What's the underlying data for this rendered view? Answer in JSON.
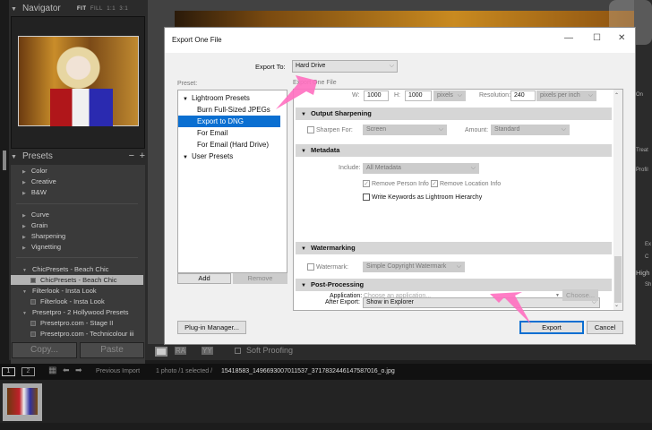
{
  "navigator": {
    "title": "Navigator",
    "options": [
      "FIT",
      "FILL",
      "1:1",
      "3:1"
    ]
  },
  "presets": {
    "title": "Presets",
    "minus": "−",
    "plus": "+",
    "items": [
      {
        "label": "Color",
        "type": "folder"
      },
      {
        "label": "Creative",
        "type": "folder"
      },
      {
        "label": "B&W",
        "type": "folder"
      },
      {
        "label": "Curve",
        "type": "folder"
      },
      {
        "label": "Grain",
        "type": "folder"
      },
      {
        "label": "Sharpening",
        "type": "folder"
      },
      {
        "label": "Vignetting",
        "type": "folder"
      },
      {
        "label": "ChicPresets - Beach Chic",
        "type": "open"
      },
      {
        "label": "ChicPresets - Beach Chic",
        "type": "preset",
        "selected": true
      },
      {
        "label": "Filterlook - Insta Look",
        "type": "open"
      },
      {
        "label": "Filterlook - Insta Look",
        "type": "preset"
      },
      {
        "label": "Presetpro - 2 Hollywood Presets",
        "type": "open"
      },
      {
        "label": "Presetpro.com - Stage II",
        "type": "preset"
      },
      {
        "label": "Presetpro.com - Technicolour iii",
        "type": "preset"
      }
    ]
  },
  "left_buttons": {
    "copy": "Copy...",
    "paste": "Paste"
  },
  "toolbar": {
    "soft_proofing": "Soft Proofing",
    "ra": "RA",
    "yy": "YY"
  },
  "right_panel": {
    "labels": [
      "On",
      "Treat",
      "Profil",
      "Ex",
      "C",
      "High",
      "Sh"
    ]
  },
  "status": {
    "pages": [
      "1",
      "2"
    ],
    "source": "Previous Import",
    "count": "1 photo /1 selected /",
    "filename": "15418583_1496693007011537_3717832446147587016_o.jpg"
  },
  "dialog": {
    "title": "Export One File",
    "export_to_label": "Export To:",
    "export_to_value": "Hard Drive",
    "preset_label": "Preset:",
    "panel_label": "Export One File",
    "preset_tree": [
      {
        "label": "Lightroom Presets",
        "type": "group"
      },
      {
        "label": "Burn Full-Sized JPEGs",
        "type": "item"
      },
      {
        "label": "Export to DNG",
        "type": "item",
        "selected": true
      },
      {
        "label": "For Email",
        "type": "item"
      },
      {
        "label": "For Email (Hard Drive)",
        "type": "item"
      },
      {
        "label": "User Presets",
        "type": "group"
      }
    ],
    "add": "Add",
    "remove": "Remove",
    "plugin_manager": "Plug-in Manager...",
    "sizing": {
      "w_label": "W:",
      "w": "1000",
      "h_label": "H:",
      "h": "1000",
      "unit": "pixels",
      "res_label": "Resolution:",
      "res": "240",
      "res_unit": "pixels per inch"
    },
    "sharpening": {
      "title": "Output Sharpening",
      "sharpen_for": "Sharpen For:",
      "sharpen_value": "Screen",
      "amount_label": "Amount:",
      "amount": "Standard"
    },
    "metadata": {
      "title": "Metadata",
      "include_label": "Include:",
      "include": "All Metadata",
      "remove_person": "Remove Person Info",
      "remove_location": "Remove Location Info",
      "write_keywords": "Write Keywords as Lightroom Hierarchy"
    },
    "watermarking": {
      "title": "Watermarking",
      "label": "Watermark:",
      "value": "Simple Copyright Watermark"
    },
    "post": {
      "title": "Post-Processing",
      "after_label": "After Export:",
      "after": "Show in Explorer",
      "app_label": "Application:",
      "app_placeholder": "Choose an application...",
      "choose": "Choose..."
    },
    "export": "Export",
    "cancel": "Cancel"
  },
  "colors": {
    "selection": "#0a6fd1",
    "annotation_arrow": "#ff6fc0"
  }
}
